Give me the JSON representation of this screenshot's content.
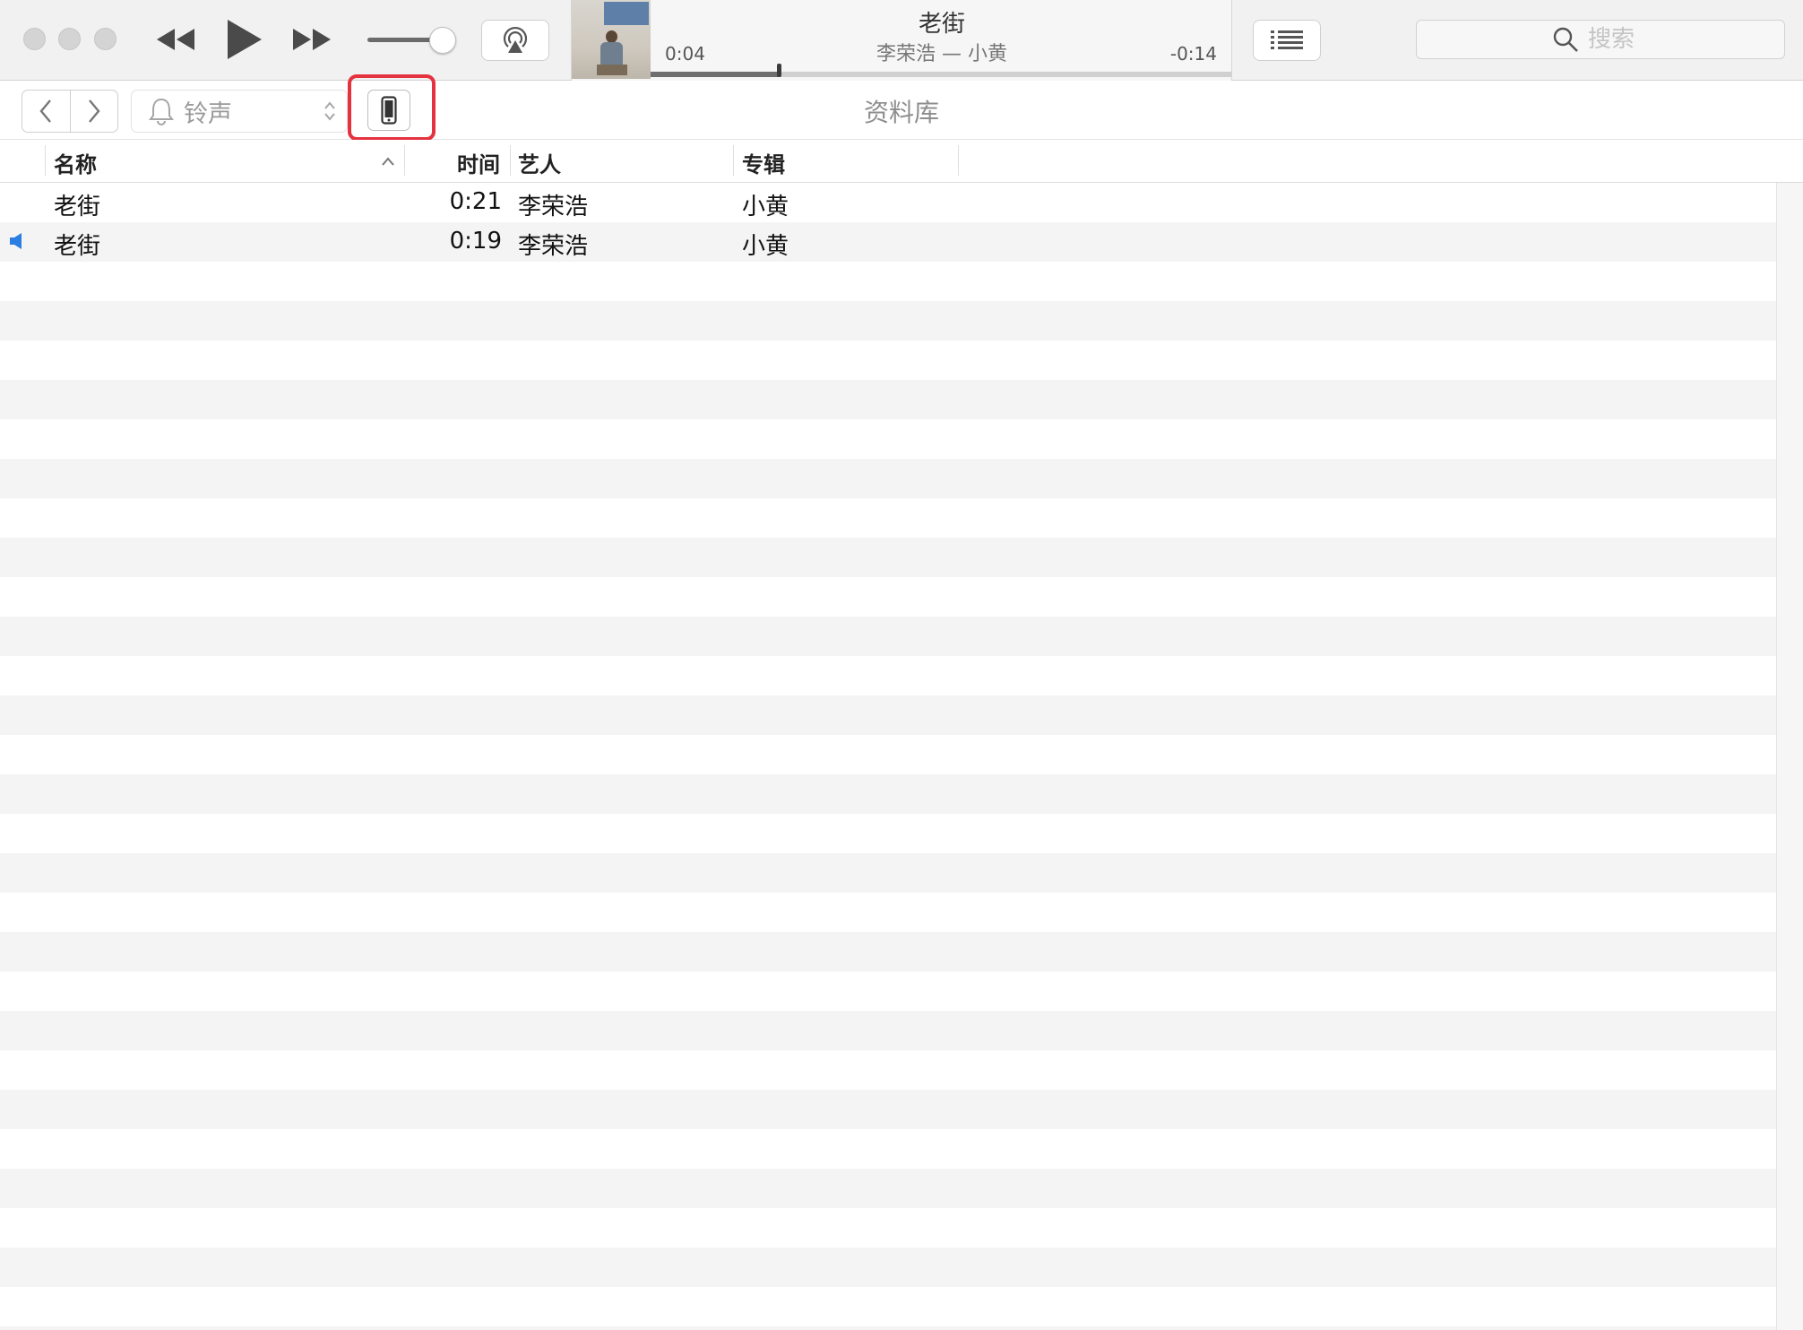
{
  "player": {
    "now_playing": {
      "title": "老街",
      "subtitle": "李荣浩 — 小黄",
      "elapsed": "0:04",
      "remaining": "-0:14",
      "progress": 0.22
    },
    "volume": 0.85
  },
  "search": {
    "placeholder": "搜索",
    "value": ""
  },
  "navbar": {
    "media_kind": "铃声",
    "section_title": "资料库"
  },
  "table": {
    "columns": {
      "name": "名称",
      "time": "时间",
      "artist": "艺人",
      "album": "专辑"
    },
    "rows": [
      {
        "name": "老街",
        "time": "0:21",
        "artist": "李荣浩",
        "album": "小黄",
        "playing": false
      },
      {
        "name": "老街",
        "time": "0:19",
        "artist": "李荣浩",
        "album": "小黄",
        "playing": true
      }
    ]
  },
  "colors": {
    "highlight_border": "#e5323f",
    "playing_indicator": "#2a7de1"
  }
}
